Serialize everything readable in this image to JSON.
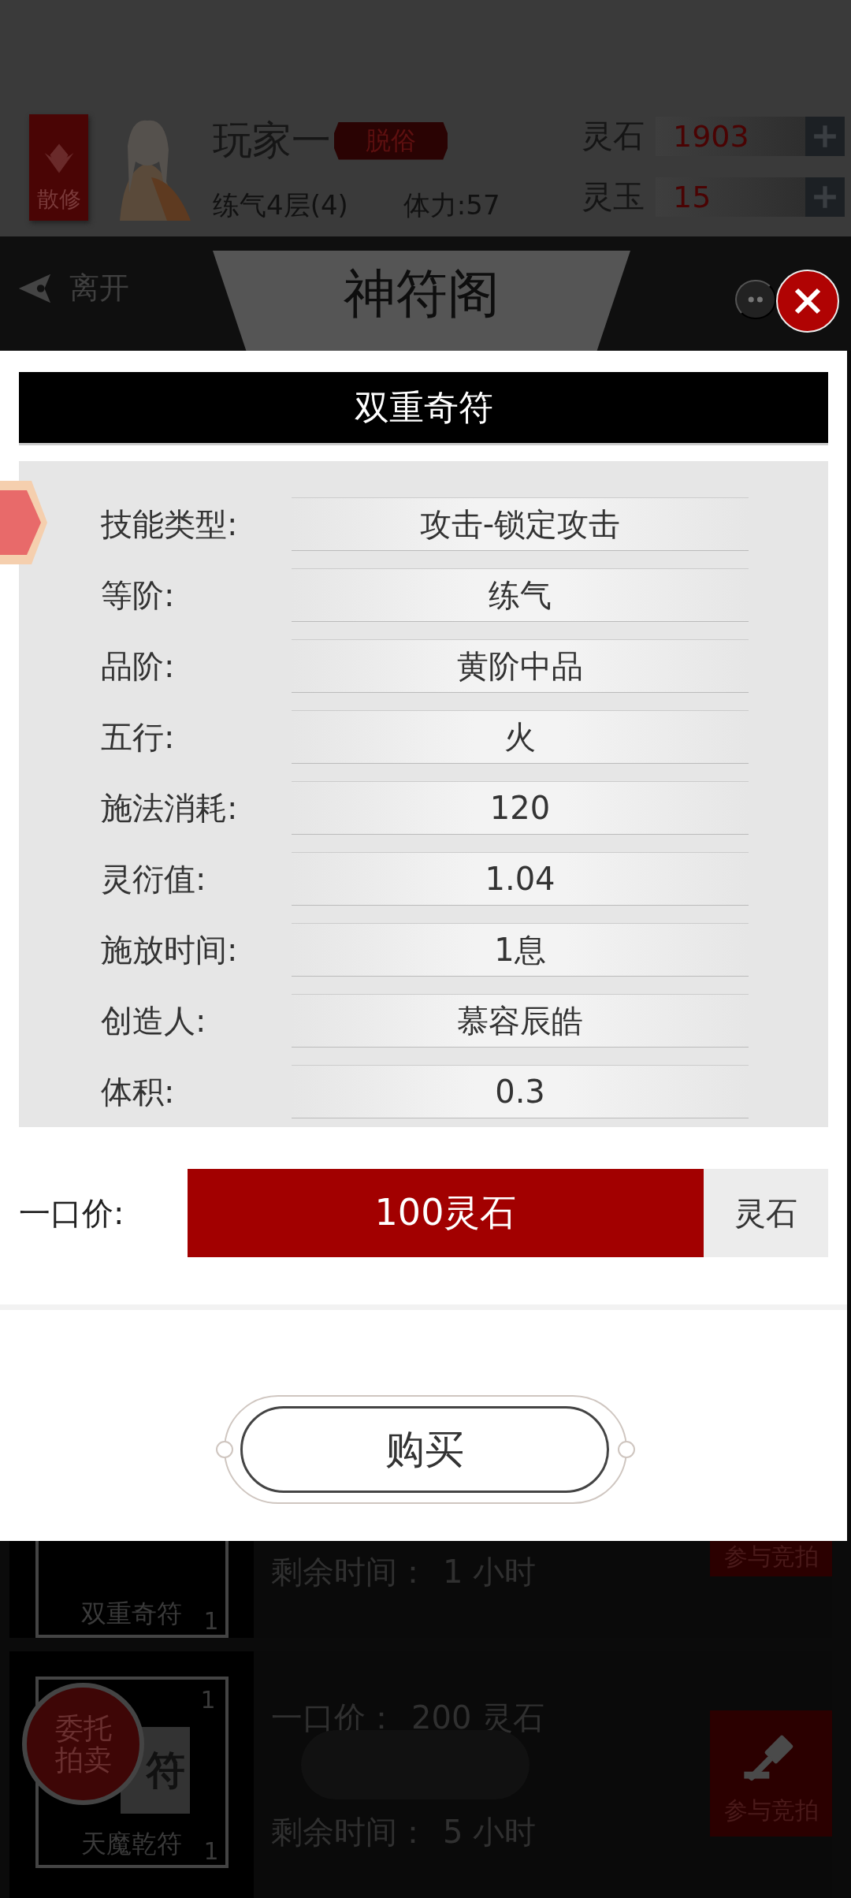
{
  "status": {
    "badge": "散修",
    "name": "玩家一",
    "rank_tag": "脱俗",
    "level": "练气4层(4)",
    "stamina": "体力:57",
    "currencies": [
      {
        "label": "灵石",
        "value": "1903"
      },
      {
        "label": "灵玉",
        "value": "15"
      }
    ]
  },
  "nav": {
    "back": "离开",
    "title": "神符阁"
  },
  "dialog": {
    "title": "双重奇符",
    "attributes": [
      {
        "label": "技能类型:",
        "value": "攻击-锁定攻击"
      },
      {
        "label": "等阶:",
        "value": "练气"
      },
      {
        "label": "品阶:",
        "value": "黄阶中品"
      },
      {
        "label": "五行:",
        "value": "火"
      },
      {
        "label": "施法消耗:",
        "value": "120"
      },
      {
        "label": "灵衍值:",
        "value": "1.04"
      },
      {
        "label": "施放时间:",
        "value": "1息"
      },
      {
        "label": "创造人:",
        "value": "慕容辰皓"
      },
      {
        "label": "体积:",
        "value": "0.3"
      }
    ],
    "price": {
      "label": "一口价:",
      "amount": "100灵石",
      "currency": "灵石"
    },
    "buy_button": "购买"
  },
  "listings": [
    {
      "name": "双重奇符",
      "count": "1",
      "remaining": "剩余时间：",
      "time": "1 小时",
      "bid_button": "参与竞拍"
    },
    {
      "top_count": "1",
      "glyph": "符",
      "name": "天魔乾符",
      "count": "1",
      "price_label": "一口价：",
      "price": "200 灵石",
      "remaining": "剩余时间：",
      "time": "5 小时",
      "bid_button": "参与竞拍"
    }
  ],
  "float_button": "委托拍卖"
}
